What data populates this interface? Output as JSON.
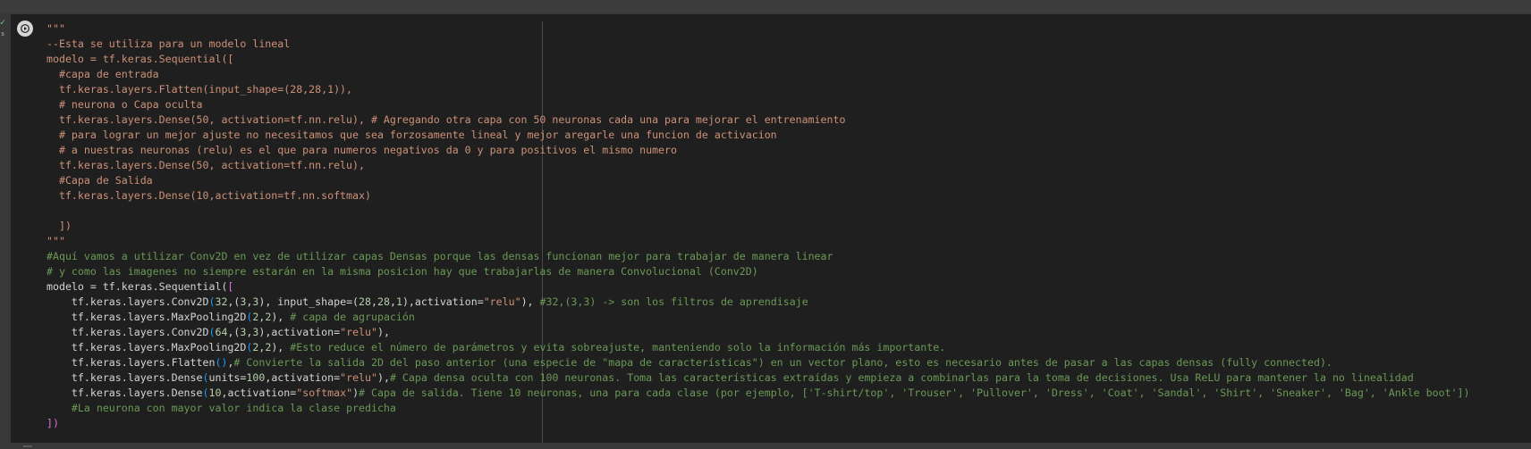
{
  "cell": {
    "status_check": "✓",
    "status_time": "s",
    "run_icon": "play-icon"
  },
  "code_lines": [
    {
      "segments": [
        {
          "t": "\"\"\"",
          "k": "s"
        }
      ]
    },
    {
      "segments": [
        {
          "t": "--Esta se utiliza para un modelo lineal",
          "k": "s"
        }
      ]
    },
    {
      "segments": [
        {
          "t": "modelo = tf.keras.Sequential([",
          "k": "s"
        }
      ]
    },
    {
      "segments": [
        {
          "t": "  #capa de entrada",
          "k": "s"
        }
      ]
    },
    {
      "segments": [
        {
          "t": "  tf.keras.layers.Flatten(input_shape=(28,28,1)),",
          "k": "s"
        }
      ]
    },
    {
      "segments": [
        {
          "t": "  # neurona o Capa oculta",
          "k": "s"
        }
      ]
    },
    {
      "segments": [
        {
          "t": "  tf.keras.layers.Dense(50, activation=tf.nn.relu), # Agregando otra capa con 50 neuronas cada una para mejorar el entrenamiento",
          "k": "s"
        }
      ]
    },
    {
      "segments": [
        {
          "t": "  # para lograr un mejor ajuste no necesitamos que sea forzosamente lineal y mejor aregarle una funcion de activacion",
          "k": "s"
        }
      ]
    },
    {
      "segments": [
        {
          "t": "  # a nuestras neuronas (relu) es el que para numeros negativos da 0 y para positivos el mismo numero",
          "k": "s"
        }
      ]
    },
    {
      "segments": [
        {
          "t": "  tf.keras.layers.Dense(50, activation=tf.nn.relu),",
          "k": "s"
        }
      ]
    },
    {
      "segments": [
        {
          "t": "  #Capa de Salida",
          "k": "s"
        }
      ]
    },
    {
      "segments": [
        {
          "t": "  tf.keras.layers.Dense(10,activation=tf.nn.softmax)",
          "k": "s"
        }
      ]
    },
    {
      "segments": [
        {
          "t": "",
          "k": "s"
        }
      ]
    },
    {
      "segments": [
        {
          "t": "  ])",
          "k": "s"
        }
      ]
    },
    {
      "segments": [
        {
          "t": "\"\"\"",
          "k": "s"
        }
      ]
    },
    {
      "segments": [
        {
          "t": "#Aquí vamos a utilizar Conv2D en vez de utilizar capas Densas porque las densas funcionan mejor para trabajar de manera linear",
          "k": "c"
        }
      ]
    },
    {
      "segments": [
        {
          "t": "# y como las imagenes no siempre estarán en la misma posicion hay que trabajarlas de manera Convolucional (Conv2D)",
          "k": "c"
        }
      ]
    },
    {
      "segments": [
        {
          "t": "modelo = tf.keras.Sequential(",
          "k": ""
        },
        {
          "t": "[",
          "k": "b"
        }
      ]
    },
    {
      "segments": [
        {
          "t": "    tf.keras.layers.Conv2D",
          "k": ""
        },
        {
          "t": "(",
          "k": "b2"
        },
        {
          "t": "32",
          "k": "n"
        },
        {
          "t": ",(",
          "k": ""
        },
        {
          "t": "3",
          "k": "n"
        },
        {
          "t": ",",
          "k": ""
        },
        {
          "t": "3",
          "k": "n"
        },
        {
          "t": "), input_shape=(",
          "k": ""
        },
        {
          "t": "28",
          "k": "n"
        },
        {
          "t": ",",
          "k": ""
        },
        {
          "t": "28",
          "k": "n"
        },
        {
          "t": ",",
          "k": ""
        },
        {
          "t": "1",
          "k": "n"
        },
        {
          "t": "),activation=",
          "k": ""
        },
        {
          "t": "\"relu\"",
          "k": "s"
        },
        {
          "t": "), ",
          "k": ""
        },
        {
          "t": "#32,(3,3) -> son los filtros de aprendisaje",
          "k": "c"
        }
      ]
    },
    {
      "segments": [
        {
          "t": "    tf.keras.layers.MaxPooling2D",
          "k": ""
        },
        {
          "t": "(",
          "k": "b2"
        },
        {
          "t": "2",
          "k": "n"
        },
        {
          "t": ",",
          "k": ""
        },
        {
          "t": "2",
          "k": "n"
        },
        {
          "t": "), ",
          "k": ""
        },
        {
          "t": "# capa de agrupación",
          "k": "c"
        }
      ]
    },
    {
      "segments": [
        {
          "t": "    tf.keras.layers.Conv2D",
          "k": ""
        },
        {
          "t": "(",
          "k": "b2"
        },
        {
          "t": "64",
          "k": "n"
        },
        {
          "t": ",(",
          "k": ""
        },
        {
          "t": "3",
          "k": "n"
        },
        {
          "t": ",",
          "k": ""
        },
        {
          "t": "3",
          "k": "n"
        },
        {
          "t": "),activation=",
          "k": ""
        },
        {
          "t": "\"relu\"",
          "k": "s"
        },
        {
          "t": "),",
          "k": ""
        }
      ]
    },
    {
      "segments": [
        {
          "t": "    tf.keras.layers.MaxPooling2D",
          "k": ""
        },
        {
          "t": "(",
          "k": "b2"
        },
        {
          "t": "2",
          "k": "n"
        },
        {
          "t": ",",
          "k": ""
        },
        {
          "t": "2",
          "k": "n"
        },
        {
          "t": "), ",
          "k": ""
        },
        {
          "t": "#Esto reduce el número de parámetros y evita sobreajuste, manteniendo solo la información más importante.",
          "k": "c"
        }
      ]
    },
    {
      "segments": [
        {
          "t": "    tf.keras.layers.Flatten",
          "k": ""
        },
        {
          "t": "()",
          "k": "b2"
        },
        {
          "t": ",",
          "k": ""
        },
        {
          "t": "# Convierte la salida 2D del paso anterior (una especie de \"mapa de características\") en un vector plano, esto es necesario antes de pasar a las capas densas (fully connected).",
          "k": "c"
        }
      ]
    },
    {
      "segments": [
        {
          "t": "    tf.keras.layers.Dense",
          "k": ""
        },
        {
          "t": "(",
          "k": "b2"
        },
        {
          "t": "units=",
          "k": ""
        },
        {
          "t": "100",
          "k": "n"
        },
        {
          "t": ",activation=",
          "k": ""
        },
        {
          "t": "\"relu\"",
          "k": "s"
        },
        {
          "t": "),",
          "k": ""
        },
        {
          "t": "# Capa densa oculta con 100 neuronas. Toma las características extraídas y empieza a combinarlas para la toma de decisiones. Usa ReLU para mantener la no linealidad",
          "k": "c"
        }
      ]
    },
    {
      "segments": [
        {
          "t": "    tf.keras.layers.Dense",
          "k": ""
        },
        {
          "t": "(",
          "k": "b2"
        },
        {
          "t": "10",
          "k": "n"
        },
        {
          "t": ",activation=",
          "k": ""
        },
        {
          "t": "\"softmax\"",
          "k": "s"
        },
        {
          "t": ")",
          "k": ""
        },
        {
          "t": "# Capa de salida. Tiene 10 neuronas, una para cada clase (por ejemplo, ['T-shirt/top', 'Trouser', 'Pullover', 'Dress', 'Coat', 'Sandal', 'Shirt', 'Sneaker', 'Bag', 'Ankle boot'])",
          "k": "c"
        }
      ]
    },
    {
      "segments": [
        {
          "t": "    ",
          "k": ""
        },
        {
          "t": "#La neurona con mayor valor indica la clase predicha",
          "k": "c"
        }
      ]
    },
    {
      "segments": [
        {
          "t": "])",
          "k": "b"
        }
      ]
    }
  ]
}
